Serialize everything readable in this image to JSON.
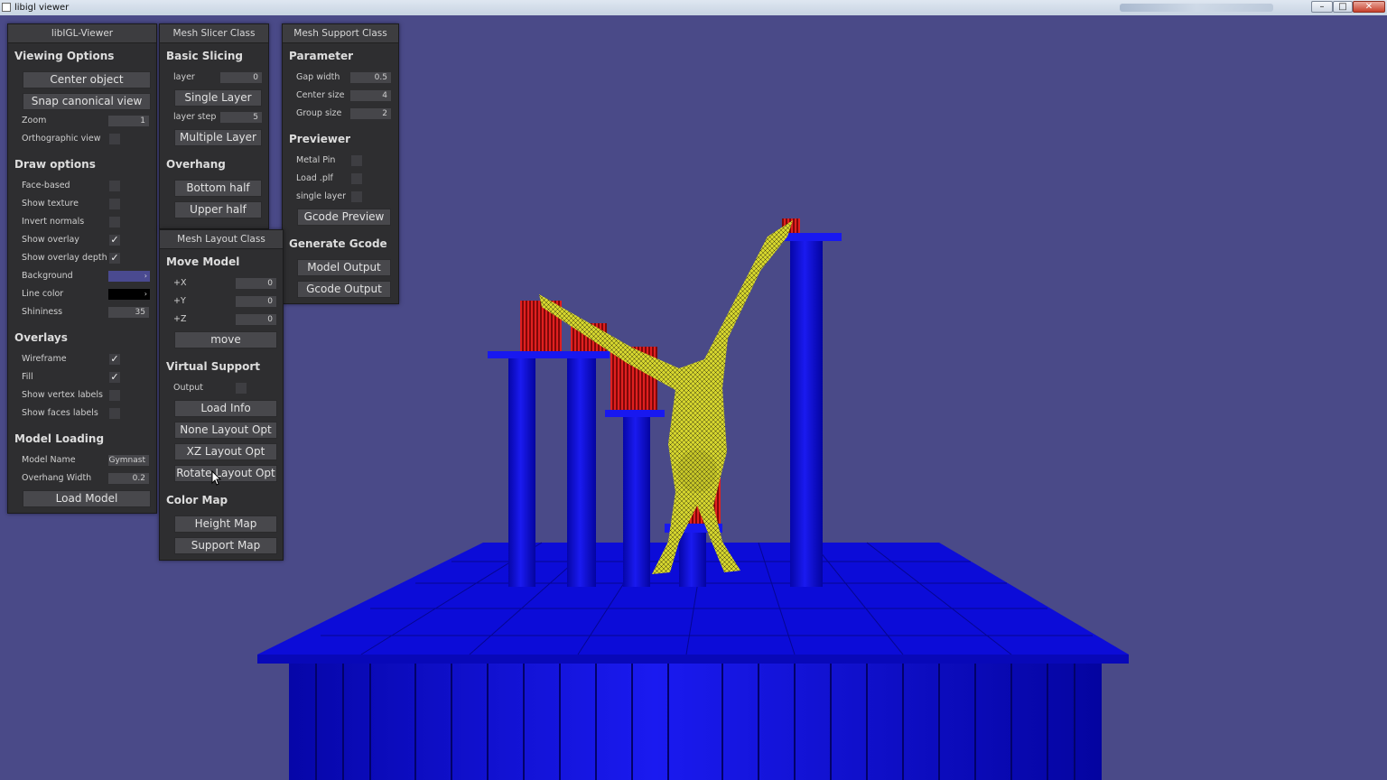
{
  "window": {
    "title": "libigl viewer"
  },
  "colors": {
    "background": "#4a4a88",
    "support": "#0a0ae6",
    "model": "#d8d830",
    "support_pins": "#c81818",
    "background_swatch": "#4a4a90",
    "line_color_swatch": "#000000"
  },
  "viewer_panel": {
    "title": "libIGL-Viewer",
    "viewing": {
      "heading": "Viewing Options",
      "center_btn": "Center object",
      "snap_btn": "Snap canonical view",
      "zoom_label": "Zoom",
      "zoom_value": "1",
      "ortho_label": "Orthographic view"
    },
    "draw": {
      "heading": "Draw options",
      "face_based": "Face-based",
      "show_texture": "Show texture",
      "invert_normals": "Invert normals",
      "show_overlay": "Show overlay",
      "show_overlay_depth": "Show overlay depth",
      "background": "Background",
      "line_color": "Line color",
      "shininess": "Shininess",
      "shininess_value": "35",
      "checked": "✓",
      "arrow": "›"
    },
    "overlays": {
      "heading": "Overlays",
      "wireframe": "Wireframe",
      "fill": "Fill",
      "vertex_labels": "Show vertex labels",
      "face_labels": "Show faces labels"
    },
    "loading": {
      "heading": "Model Loading",
      "model_name_label": "Model Name",
      "model_name_value": "Gymnast",
      "overhang_label": "Overhang Width",
      "overhang_value": "0.2",
      "load_btn": "Load Model"
    }
  },
  "slicer_panel": {
    "title": "Mesh Slicer Class",
    "basic": {
      "heading": "Basic Slicing",
      "layer_label": "layer",
      "layer_value": "0",
      "single_btn": "Single Layer",
      "step_label": "layer step",
      "step_value": "5",
      "multiple_btn": "Multiple Layer"
    },
    "overhang": {
      "heading": "Overhang",
      "bottom_btn": "Bottom half",
      "upper_btn": "Upper half"
    }
  },
  "support_panel": {
    "title": "Mesh Support Class",
    "parameter": {
      "heading": "Parameter",
      "gap_label": "Gap width",
      "gap_value": "0.5",
      "center_label": "Center size",
      "center_value": "4",
      "group_label": "Group size",
      "group_value": "2"
    },
    "previewer": {
      "heading": "Previewer",
      "metal_pin": "Metal Pin",
      "load_plf": "Load .plf",
      "single_layer": "single layer",
      "gcode_preview_btn": "Gcode Preview"
    },
    "generate": {
      "heading": "Generate Gcode",
      "model_output_btn": "Model Output",
      "gcode_output_btn": "Gcode Output"
    }
  },
  "layout_panel": {
    "title": "Mesh Layout Class",
    "move": {
      "heading": "Move Model",
      "x_label": "+X",
      "x_value": "0",
      "y_label": "+Y",
      "y_value": "0",
      "z_label": "+Z",
      "z_value": "0",
      "move_btn": "move"
    },
    "virtual": {
      "heading": "Virtual Support",
      "output_label": "Output",
      "load_info_btn": "Load Info",
      "none_btn": "None Layout Opt",
      "xz_btn": "XZ Layout Opt",
      "rotate_btn": "Rotate Layout Opt"
    },
    "colormap": {
      "heading": "Color Map",
      "height_btn": "Height Map",
      "support_btn": "Support Map"
    }
  },
  "controls": {
    "minimize": "–",
    "maximize": "□",
    "close": "✕"
  }
}
